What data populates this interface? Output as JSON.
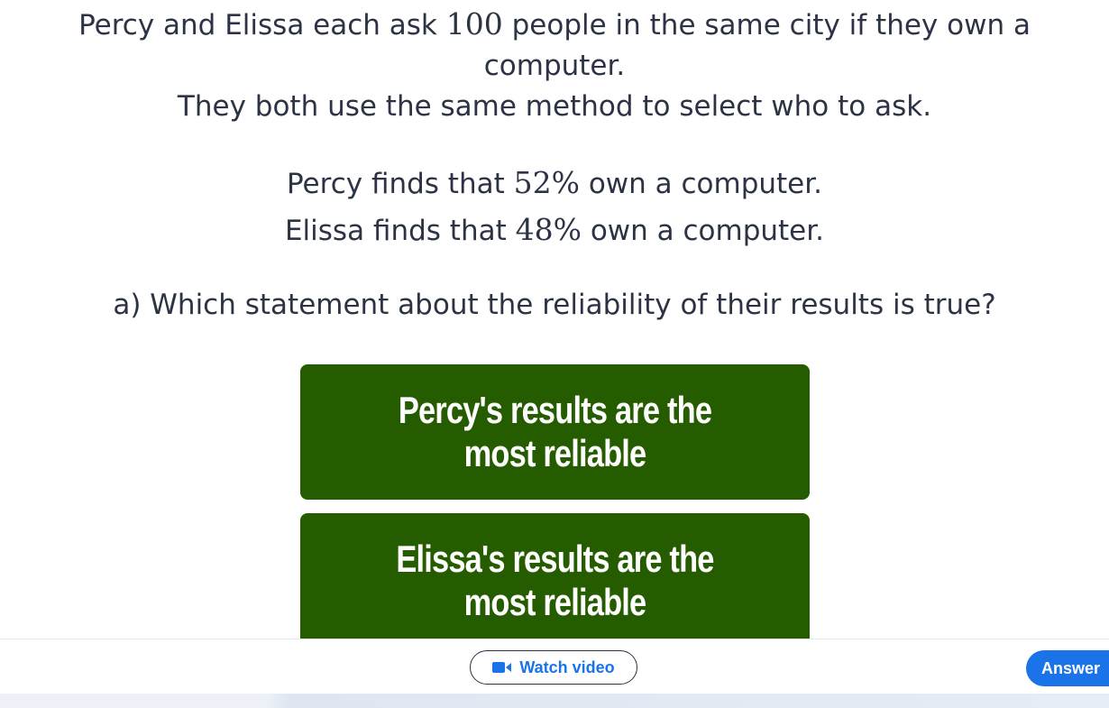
{
  "question": {
    "line1_pre": "Percy and Elissa each ask ",
    "line1_num": "100",
    "line1_post": " people in the same city if they own a",
    "line2": "computer.",
    "line3": "They both use the same method to select who to ask.",
    "line4_pre": "Percy finds that ",
    "line4_num": "52%",
    "line4_post": " own a computer.",
    "line5_pre": "Elissa finds that ",
    "line5_num": "48%",
    "line5_post": " own a computer.",
    "prompt": "a) Which statement about the reliability of their results is true?"
  },
  "options": [
    {
      "label": "Percy's results are the most reliable"
    },
    {
      "label": "Elissa's results are the most reliable"
    }
  ],
  "footer": {
    "watch_video_label": "Watch video",
    "answer_label": "Answer"
  },
  "colors": {
    "option_bg": "#265c00",
    "accent_blue": "#1a73e8",
    "text": "#2b3344"
  },
  "icons": {
    "watch_video": "video-camera-icon"
  }
}
